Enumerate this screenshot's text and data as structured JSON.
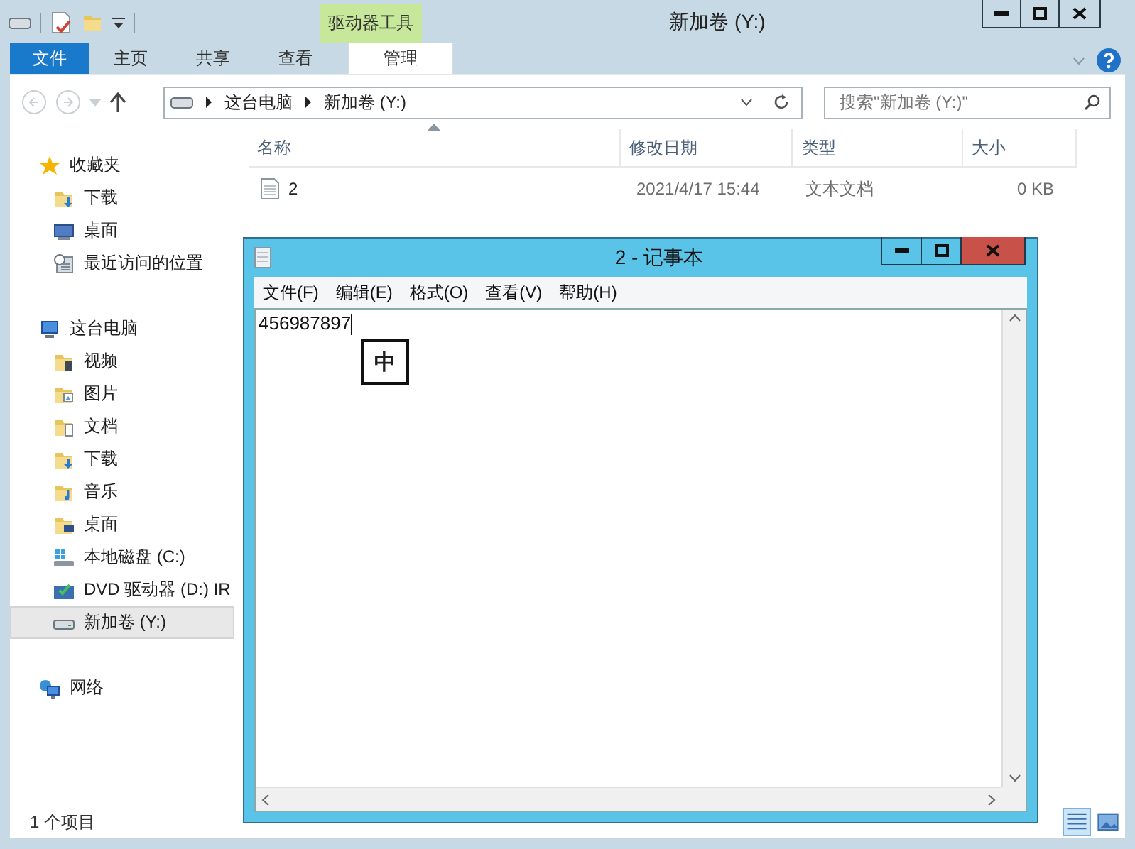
{
  "window": {
    "title": "新加卷 (Y:)",
    "context_tab": "驱动器工具"
  },
  "ribbon_tabs": [
    {
      "label": "文件",
      "kind": "file",
      "selected": false
    },
    {
      "label": "主页",
      "kind": "tab",
      "selected": false
    },
    {
      "label": "共享",
      "kind": "tab",
      "selected": false
    },
    {
      "label": "查看",
      "kind": "tab",
      "selected": false
    },
    {
      "label": "管理",
      "kind": "context",
      "selected": false
    }
  ],
  "address": {
    "breadcrumbs": [
      "这台电脑",
      "新加卷 (Y:)"
    ]
  },
  "search": {
    "placeholder": "搜索\"新加卷 (Y:)\""
  },
  "sidebar": {
    "groups": [
      {
        "label": "收藏夹",
        "kind": "star",
        "children": [
          {
            "label": "下载",
            "kind": "download",
            "selected": false
          },
          {
            "label": "桌面",
            "kind": "desktop",
            "selected": false
          },
          {
            "label": "最近访问的位置",
            "kind": "recent",
            "selected": false
          }
        ]
      },
      {
        "label": "这台电脑",
        "kind": "pc",
        "children": [
          {
            "label": "视频",
            "kind": "video",
            "selected": false
          },
          {
            "label": "图片",
            "kind": "picture",
            "selected": false
          },
          {
            "label": "文档",
            "kind": "document",
            "selected": false
          },
          {
            "label": "下载",
            "kind": "download",
            "selected": false
          },
          {
            "label": "音乐",
            "kind": "music",
            "selected": false
          },
          {
            "label": "桌面",
            "kind": "desktopfolder",
            "selected": false
          },
          {
            "label": "本地磁盘 (C:)",
            "kind": "disk",
            "selected": false
          },
          {
            "label": "DVD 驱动器 (D:) IR",
            "kind": "dvd",
            "selected": false
          },
          {
            "label": "新加卷 (Y:)",
            "kind": "drive",
            "selected": true
          }
        ]
      },
      {
        "label": "网络",
        "kind": "network"
      }
    ]
  },
  "table": {
    "columns": [
      {
        "label": "名称",
        "sorted": true
      },
      {
        "label": "修改日期",
        "sorted": false
      },
      {
        "label": "类型",
        "sorted": false
      },
      {
        "label": "大小",
        "sorted": false
      }
    ],
    "rows": [
      {
        "cells": [
          "2",
          "2021/4/17 15:44",
          "文本文档",
          "0 KB"
        ]
      }
    ]
  },
  "status_bar": {
    "text": "1 个项目",
    "views": [
      {
        "kind": "details",
        "selected": true
      },
      {
        "kind": "icons",
        "selected": false
      }
    ]
  },
  "notepad": {
    "title": "2 - 记事本",
    "menu": [
      "文件(F)",
      "编辑(E)",
      "格式(O)",
      "查看(V)",
      "帮助(H)"
    ],
    "text": "456987897",
    "ime": "中"
  }
}
